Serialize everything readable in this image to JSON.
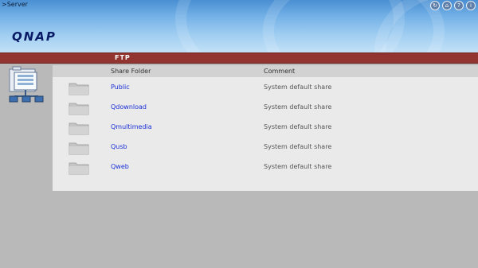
{
  "breadcrumb": ">Server",
  "brand": {
    "logo_text": "QNAP"
  },
  "top_icons": [
    "refresh-icon",
    "home-icon",
    "help-icon",
    "info-icon"
  ],
  "title": "FTP",
  "columns": {
    "folder": "Share Folder",
    "comment": "Comment"
  },
  "shares": [
    {
      "name": "Public",
      "comment": "System default share"
    },
    {
      "name": "Qdownload",
      "comment": "System default share"
    },
    {
      "name": "Qmultimedia",
      "comment": "System default share"
    },
    {
      "name": "Qusb",
      "comment": "System default share"
    },
    {
      "name": "Qweb",
      "comment": "System default share"
    }
  ],
  "colors": {
    "title_bar": "#923530",
    "link": "#1a2fd6",
    "panel": "#eaeaea",
    "background": "#b9b9b9"
  }
}
